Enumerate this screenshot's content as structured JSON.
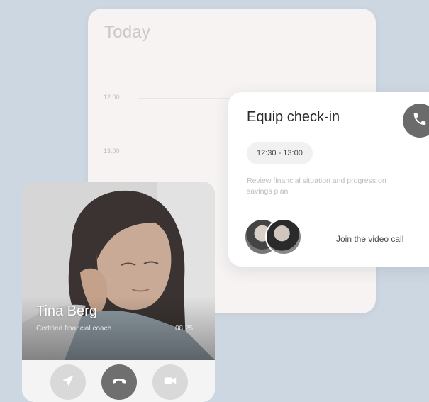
{
  "calendar": {
    "title": "Today",
    "times": [
      "12:00",
      "13:00"
    ]
  },
  "event": {
    "title": "Equip check-in",
    "time_range": "12:30 - 13:00",
    "description": "Review financial situation and progress on savings plan",
    "join_label": "Join the video call",
    "phone_icon": "phone-icon"
  },
  "call": {
    "caller_name": "Tina Berg",
    "caller_role": "Certified financial coach",
    "timer": "08:25",
    "controls": [
      "share-icon",
      "hang-up-icon",
      "video-icon"
    ]
  },
  "colors": {
    "background": "#cdd7e1",
    "card": "#ffffff",
    "calendar_card": "#f6f3f2",
    "hang_up": "#6f6f6f",
    "secondary_control": "#d9d9d9"
  }
}
